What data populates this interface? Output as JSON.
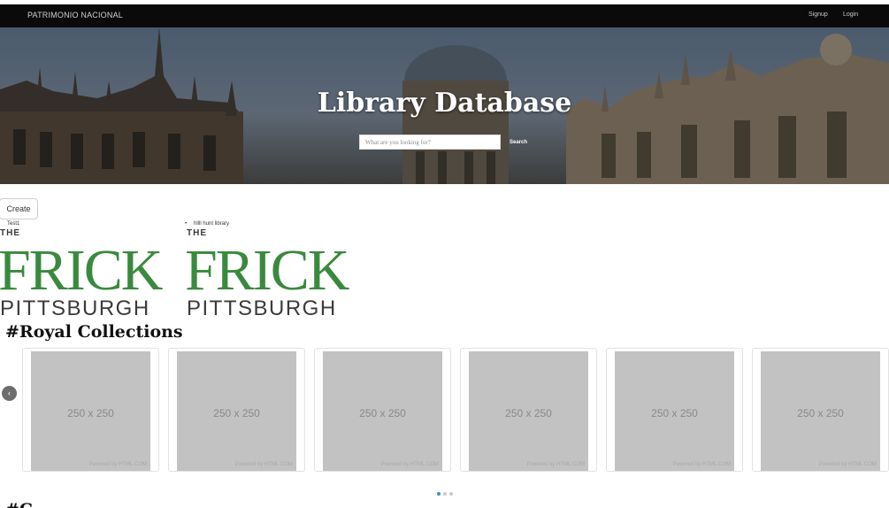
{
  "navbar": {
    "brand": "PATRIMONIO NACIONAL",
    "signup": "Signup",
    "login": "Login"
  },
  "hero": {
    "title": "Library Database",
    "search_placeholder": "What are you looking for?",
    "search_button": "Search"
  },
  "create_button": "Create",
  "cards": [
    {
      "title": "Test1",
      "logo_top": "THE",
      "logo_main": "FRICK",
      "logo_bottom": "PITTSBURGH"
    },
    {
      "title": "hllll hunt library",
      "logo_top": "THE",
      "logo_main": "FRICK",
      "logo_bottom": "PITTSBURGH"
    }
  ],
  "bullet": "•",
  "section": {
    "title": "#Royal Collections",
    "next_title": "#C"
  },
  "carousel": {
    "prev_icon": "‹",
    "next_icon": "›",
    "items": [
      {
        "label": "250 x 250",
        "credit": "Powered by HTML.COM"
      },
      {
        "label": "250 x 250",
        "credit": "Powered by HTML.COM"
      },
      {
        "label": "250 x 250",
        "credit": "Powered by HTML.COM"
      },
      {
        "label": "250 x 250",
        "credit": "Powered by HTML.COM"
      },
      {
        "label": "250 x 250",
        "credit": "Powered by HTML.COM"
      },
      {
        "label": "250 x 250",
        "credit": "Powered by HTML.COM"
      }
    ],
    "indicator_count": 3,
    "active_indicator": 1
  },
  "colors": {
    "navbar_bg": "#0a0a0a",
    "logo_green": "#3a8a3e",
    "logo_gray": "#3b3b3b",
    "placeholder_bg": "#c2c2c2",
    "dot_active": "#3c8dc8"
  }
}
